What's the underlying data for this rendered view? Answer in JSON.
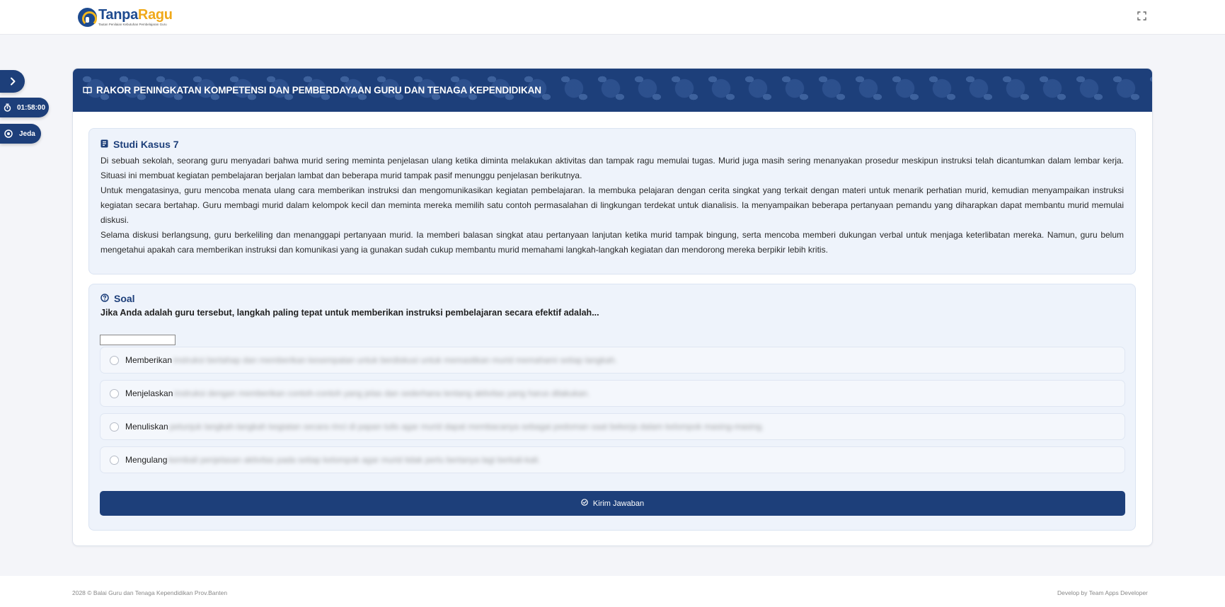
{
  "header": {
    "logo_brand_1": "Tanpa",
    "logo_brand_2": "Ragu",
    "logo_tagline": "Tautan Penilaian Kebutuhan Pembelajaran Guru",
    "fullscreen_icon": "expand-icon"
  },
  "sidebar": {
    "toggle_icon": "chevron-right-icon",
    "timer_icon": "stopwatch-icon",
    "timer_value": "01:58:00",
    "pause_icon": "pause-circle-icon",
    "pause_label": "Jeda"
  },
  "card": {
    "title": "RAKOR PENINGKATAN KOMPETENSI DAN PEMBERDAYAAN GURU DAN TENAGA KEPENDIDIKAN",
    "title_icon": "book-open-icon"
  },
  "case_study": {
    "heading": "Studi Kasus 7",
    "heading_icon": "document-icon",
    "paragraphs": [
      "Di sebuah sekolah, seorang guru menyadari bahwa murid sering meminta penjelasan ulang ketika diminta melakukan aktivitas dan tampak ragu memulai tugas. Murid juga masih sering menanyakan prosedur meskipun instruksi telah dicantumkan dalam lembar kerja. Situasi ini membuat kegiatan pembelajaran berjalan lambat dan beberapa murid tampak pasif menunggu penjelasan berikutnya.",
      "Untuk mengatasinya, guru mencoba menata ulang cara memberikan instruksi dan mengomunikasikan kegiatan pembelajaran. Ia membuka pelajaran dengan cerita singkat yang terkait dengan materi untuk menarik perhatian murid, kemudian menyampaikan instruksi kegiatan secara bertahap. Guru membagi murid dalam kelompok kecil dan meminta mereka memilih satu contoh permasalahan di lingkungan terdekat untuk dianalisis. Ia menyampaikan beberapa pertanyaan pemandu yang diharapkan dapat membantu murid memulai diskusi.",
      "Selama diskusi berlangsung, guru berkeliling dan menanggapi pertanyaan murid. Ia memberi balasan singkat atau pertanyaan lanjutan ketika murid tampak bingung, serta mencoba memberi dukungan verbal untuk menjaga keterlibatan mereka. Namun, guru belum mengetahui apakah cara memberikan instruksi dan komunikasi yang ia gunakan sudah cukup membantu murid memahami langkah-langkah kegiatan dan mendorong mereka berpikir lebih kritis."
    ]
  },
  "question": {
    "heading": "Soal",
    "heading_icon": "question-circle-icon",
    "text": "Jika Anda adalah guru tersebut, langkah paling tepat untuk memberikan instruksi pembelajaran secara efektif adalah...",
    "options": [
      {
        "label": "Memberikan",
        "obscured": "instruksi bertahap dan memberikan kesempatan untuk berdiskusi untuk memastikan murid memahami setiap langkah."
      },
      {
        "label": "Menjelaskan",
        "obscured": "instruksi dengan memberikan contoh-contoh yang jelas dan sederhana tentang aktivitas yang harus dilakukan."
      },
      {
        "label": "Menuliskan",
        "obscured": "petunjuk langkah-langkah kegiatan secara rinci di papan tulis agar murid dapat membacanya sebagai pedoman saat bekerja dalam kelompok masing-masing."
      },
      {
        "label": "Mengulang",
        "obscured": "kembali penjelasan aktivitas pada setiap kelompok agar murid tidak perlu bertanya lagi berkali-kali."
      }
    ],
    "submit_icon": "check-circle-icon",
    "submit_label": "Kirim Jawaban"
  },
  "footer": {
    "left": "2028 © Balai Guru dan Tenaga Kependidikan Prov.Banten",
    "right": "Develop by Team Apps Developer"
  },
  "colors": {
    "primary": "#1d3f7a",
    "accent": "#f0a91a",
    "panel_bg": "#eef3fb"
  }
}
